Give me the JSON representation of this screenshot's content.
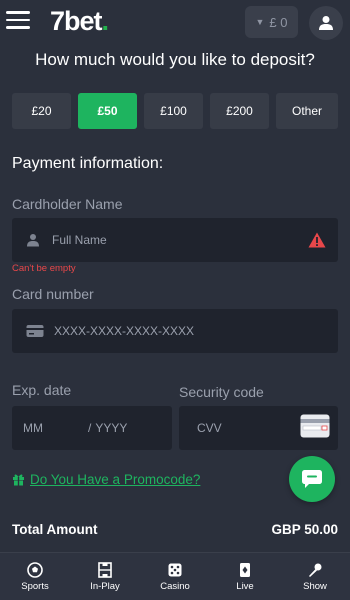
{
  "header": {
    "logo_main": "7bet",
    "logo_dot": ".",
    "balance": "£ 0",
    "balance_caret": "▼"
  },
  "deposit": {
    "question": "How much would you like to deposit?",
    "amounts": [
      "£20",
      "£50",
      "£100",
      "£200",
      "Other"
    ],
    "selected": "£50"
  },
  "payment": {
    "title": "Payment information:",
    "cardholder_label": "Cardholder Name",
    "cardholder_placeholder": "Full Name",
    "cardholder_error": "Can't be empty",
    "card_number_label": "Card number",
    "card_number_placeholder": "XXXX-XXXX-XXXX-XXXX",
    "exp_label": "Exp. date",
    "exp_month_placeholder": "MM",
    "exp_separator": "/",
    "exp_year_placeholder": "YYYY",
    "security_label": "Security code",
    "cvv_placeholder": "CVV"
  },
  "promo": {
    "label": "Do You Have a Promocode?"
  },
  "total": {
    "label": "Total Amount",
    "value": "GBP 50.00"
  },
  "nav": {
    "items": [
      "Sports",
      "In-Play",
      "Casino",
      "Live",
      "Show"
    ]
  },
  "colors": {
    "accent": "#1eb45f",
    "error": "#e8474a",
    "background": "#2b303c"
  }
}
